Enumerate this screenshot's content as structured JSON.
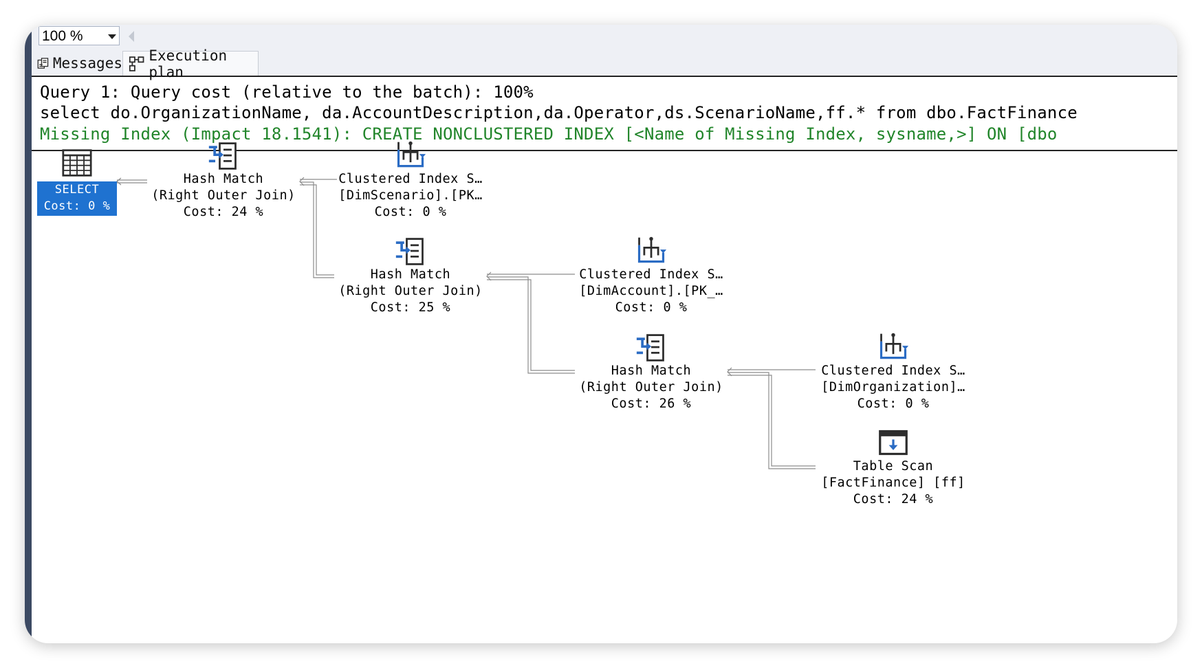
{
  "toolbar": {
    "zoom_value": "100 %"
  },
  "tabs": [
    {
      "label": "Messages",
      "active": false
    },
    {
      "label": "Execution plan",
      "active": true
    }
  ],
  "query": {
    "header": "Query 1: Query cost (relative to the batch): 100%",
    "sql": "select do.OrganizationName, da.AccountDescription,da.Operator,ds.ScenarioName,ff.* from dbo.FactFinance",
    "missing_index": "Missing Index (Impact 18.1541): CREATE NONCLUSTERED INDEX [<Name of Missing Index, sysname,>] ON [dbo"
  },
  "plan": {
    "select": {
      "line1": "SELECT",
      "line2": "Cost: 0 %",
      "icon": "result-grid-icon"
    },
    "hash1": {
      "line1": "Hash Match",
      "line2": "(Right Outer Join)",
      "line3": "Cost: 24 %",
      "icon": "hash-match-icon"
    },
    "hash2": {
      "line1": "Hash Match",
      "line2": "(Right Outer Join)",
      "line3": "Cost: 25 %",
      "icon": "hash-match-icon"
    },
    "hash3": {
      "line1": "Hash Match",
      "line2": "(Right Outer Join)",
      "line3": "Cost: 26 %",
      "icon": "hash-match-icon"
    },
    "cis1": {
      "line1": "Clustered Index S…",
      "line2": "[DimScenario].[PK…",
      "line3": "Cost: 0 %",
      "icon": "clustered-index-scan-icon"
    },
    "cis2": {
      "line1": "Clustered Index S…",
      "line2": "[DimAccount].[PK_…",
      "line3": "Cost: 0 %",
      "icon": "clustered-index-scan-icon"
    },
    "cis3": {
      "line1": "Clustered Index S…",
      "line2": "[DimOrganization]…",
      "line3": "Cost: 0 %",
      "icon": "clustered-index-scan-icon"
    },
    "scan": {
      "line1": "Table Scan",
      "line2": "[FactFinance] [ff]",
      "line3": "Cost: 24 %",
      "icon": "table-scan-icon"
    }
  },
  "colors": {
    "accent": "#1f72d0",
    "missing_index": "#21852a",
    "icon_blue": "#2b6cc4",
    "icon_dark": "#2d2d2d"
  }
}
